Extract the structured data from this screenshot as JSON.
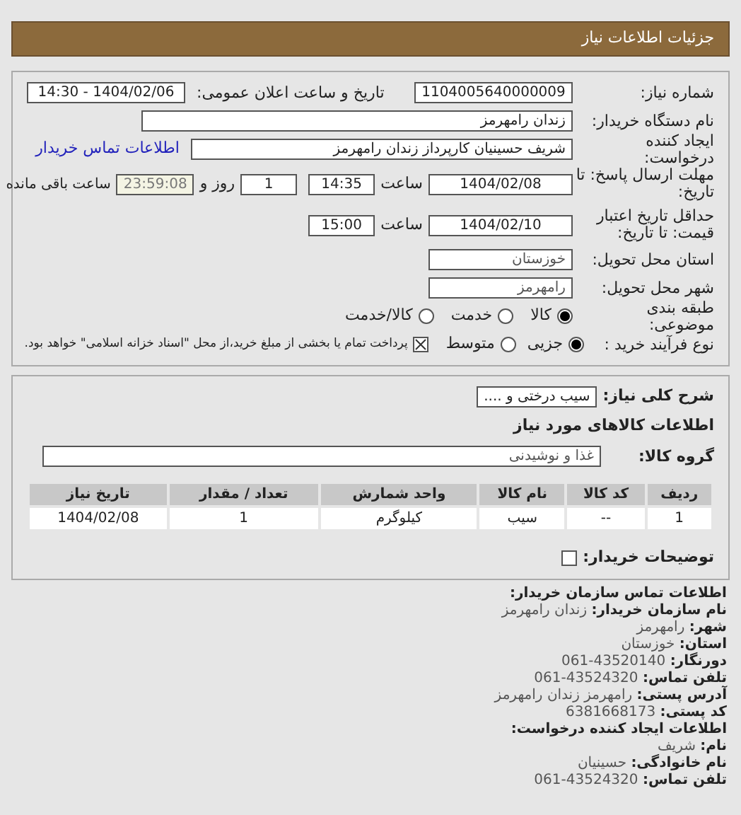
{
  "header": {
    "title": "جزئیات اطلاعات نیاز"
  },
  "need_number": {
    "label": "شماره نیاز:",
    "value": "1104005640000009"
  },
  "announce": {
    "label": "تاریخ و ساعت اعلان عمومی:",
    "value": "1404/02/06 - 14:30"
  },
  "buyer_org": {
    "label": "نام دستگاه خریدار:",
    "value": "زندان رامهرمز"
  },
  "requester": {
    "label": "ایجاد کننده درخواست:",
    "value": "شریف حسینیان کارپرداز زندان رامهرمز",
    "link": "اطلاعات تماس خریدار"
  },
  "deadline": {
    "label": "مهلت ارسال پاسخ: تا تاریخ:",
    "date": "1404/02/08",
    "time_label": "ساعت",
    "time": "14:35",
    "days": "1",
    "days_label": "روز و",
    "remaining": "23:59:08",
    "remaining_label": "ساعت باقی مانده"
  },
  "validity": {
    "label": "حداقل تاریخ اعتبار قیمت: تا تاریخ:",
    "date": "1404/02/10",
    "time_label": "ساعت",
    "time": "15:00"
  },
  "province": {
    "label": "استان محل تحویل:",
    "value": "خوزستان"
  },
  "city": {
    "label": "شهر محل تحویل:",
    "value": "رامهرمز"
  },
  "category": {
    "label": "طبقه بندی موضوعی:",
    "options": [
      {
        "label": "کالا",
        "selected": true
      },
      {
        "label": "خدمت",
        "selected": false
      },
      {
        "label": "کالا/خدمت",
        "selected": false
      }
    ]
  },
  "process": {
    "label": "نوع فرآیند خرید :",
    "options": [
      {
        "label": "جزیی",
        "selected": true
      },
      {
        "label": "متوسط",
        "selected": false
      }
    ],
    "payment": {
      "checked": true,
      "label": "پرداخت تمام یا بخشی از مبلغ خرید،از محل \"اسناد خزانه اسلامی\" خواهد بود."
    }
  },
  "description": {
    "label": "شرح کلی نیاز:",
    "value": "سیب درختی و ...."
  },
  "goods": {
    "title": "اطلاعات کالاهای مورد نیاز",
    "group_label": "گروه کالا:",
    "group_value": "غذا و نوشیدنی",
    "columns": [
      "ردیف",
      "کد کالا",
      "نام کالا",
      "واحد شمارش",
      "تعداد / مقدار",
      "تاریخ نیاز"
    ],
    "rows": [
      [
        "1",
        "--",
        "سیب",
        "کیلوگرم",
        "1",
        "1404/02/08"
      ]
    ]
  },
  "buyer_notes": {
    "label": "توضیحات خریدار:",
    "checked": false
  },
  "contact": {
    "title": "اطلاعات تماس سازمان خریدار:",
    "lines": [
      {
        "label": "نام سازمان خریدار:",
        "value": "زندان رامهرمز"
      },
      {
        "label": "شهر:",
        "value": "رامهرمز"
      },
      {
        "label": "استان:",
        "value": "خوزستان"
      },
      {
        "label": "دورنگار:",
        "value": "43520140-061"
      },
      {
        "label": "تلفن تماس:",
        "value": "43524320-061"
      },
      {
        "label": "آدرس پستی:",
        "value": "رامهرمز زندان رامهرمز"
      },
      {
        "label": "کد پستی:",
        "value": "6381668173"
      }
    ]
  },
  "creator": {
    "title": "اطلاعات ایجاد کننده درخواست:",
    "lines": [
      {
        "label": "نام:",
        "value": "شریف"
      },
      {
        "label": "نام خانوادگی:",
        "value": "حسینیان"
      },
      {
        "label": "تلفن تماس:",
        "value": "43524320-061"
      }
    ]
  }
}
